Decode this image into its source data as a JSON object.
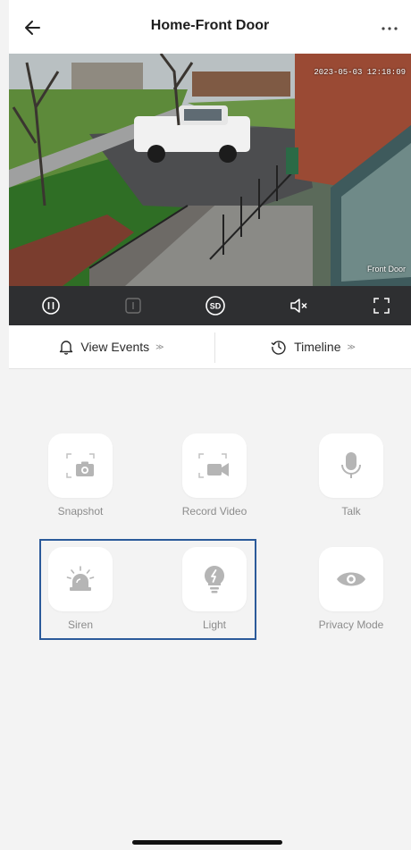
{
  "header": {
    "title": "Home-Front Door"
  },
  "video": {
    "timestamp": "2023-05-03 12:18:09",
    "camera_name": "Front Door"
  },
  "controls": [
    {
      "name": "pause-icon"
    },
    {
      "name": "stop-icon"
    },
    {
      "name": "sd-quality-icon",
      "label": "SD"
    },
    {
      "name": "mute-icon"
    },
    {
      "name": "fullscreen-icon"
    }
  ],
  "tabs": {
    "view_events": "View Events",
    "timeline": "Timeline",
    "chevron": "≫"
  },
  "actions": {
    "snapshot": "Snapshot",
    "record_video": "Record Video",
    "talk": "Talk",
    "siren": "Siren",
    "light": "Light",
    "privacy_mode": "Privacy Mode"
  },
  "colors": {
    "highlight_border": "#2b5a9a",
    "control_bar": "#2e2f31",
    "icon_gray": "#b5b5b5"
  }
}
